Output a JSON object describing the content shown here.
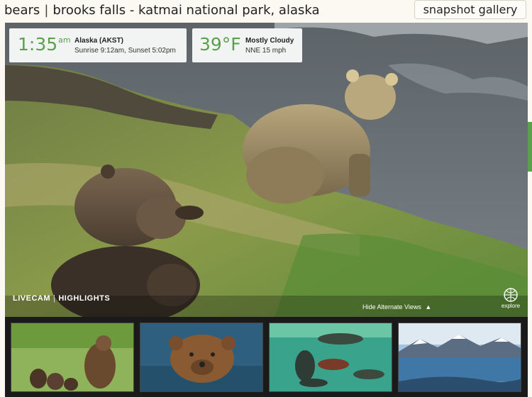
{
  "breadcrumb": {
    "section": "bears",
    "separator": "|",
    "location": "brooks falls - katmai national park, alaska"
  },
  "gallery_button": "snapshot gallery",
  "weather": {
    "time": "1:35",
    "ampm": "am",
    "timezone": "Alaska (AKST)",
    "sun": "Sunrise 9:12am, Sunset 5:02pm",
    "temperature": "39°F",
    "condition": "Mostly Cloudy",
    "wind": "NNE 15 mph"
  },
  "player": {
    "livecam": "LIVECAM",
    "divider": "|",
    "highlights": "HIGHLIGHTS",
    "hide_alternate": "Hide Alternate Views",
    "brand": "explore"
  },
  "thumbnails": [
    {
      "icon": "bear-cubs-meadow-thumb"
    },
    {
      "icon": "bear-swimming-thumb"
    },
    {
      "icon": "salmon-underwater-thumb"
    },
    {
      "icon": "lake-mountains-thumb"
    }
  ],
  "colors": {
    "accent_green": "#5aa04d",
    "page_bg": "#fbf9f2"
  }
}
